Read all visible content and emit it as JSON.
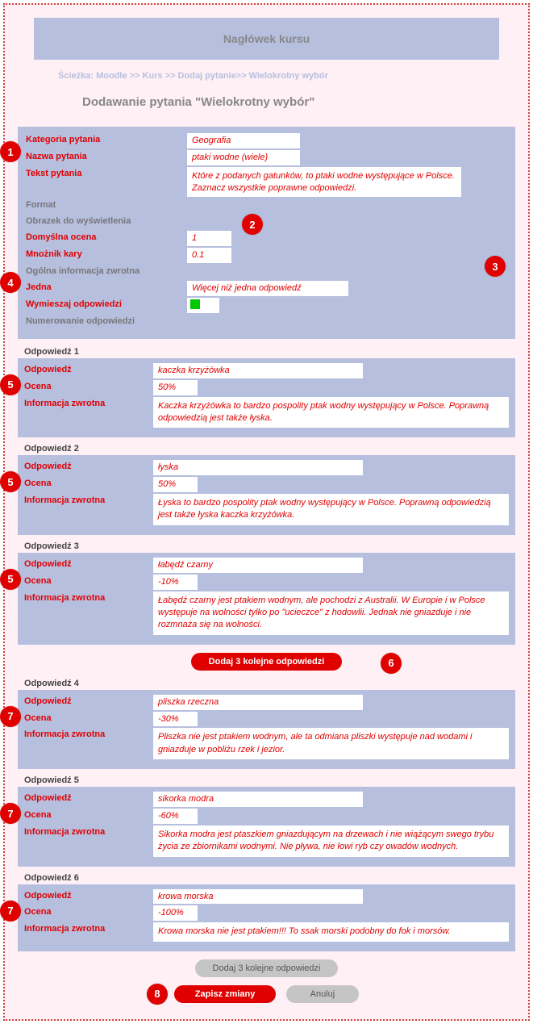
{
  "header": {
    "course_title": "Nagłówek kursu",
    "breadcrumb": "Ścieżka: Moodle >> Kurs >> Dodaj pytanie>> Wielokrotny wybór",
    "page_title": "Dodawanie pytania \"Wielokrotny wybór\""
  },
  "form": {
    "labels": {
      "category": "Kategoria pytania",
      "name": "Nazwa pytania",
      "text": "Tekst pytania",
      "format": "Format",
      "image": "Obrazek do wyświetlenia",
      "default_grade": "Domyślna ocena",
      "penalty": "Mnożnik kary",
      "general_fb": "Ogólna informacja zwrotna",
      "single": "Jedna",
      "shuffle": "Wymieszaj odpowiedzi",
      "numbering": "Numerowanie odpowiedzi"
    },
    "values": {
      "category": "Geografia",
      "name": "ptaki wodne (wiele)",
      "text": "Które z podanych gatunków, to ptaki wodne występujące w Polsce. Zaznacz wszystkie poprawne odpowiedzi.",
      "default_grade": "1",
      "penalty": "0.1",
      "single": "Więcej niż jedna odpowiedź"
    }
  },
  "ans_labels": {
    "answer": "Odpowiedź",
    "grade": "Ocena",
    "feedback": "Informacja zwrotna"
  },
  "answers": [
    {
      "title": "Odpowiedź 1",
      "answer": "kaczka krzyżówka",
      "grade": "50%",
      "feedback": "Kaczka krzyżówka to bardzo pospolity ptak wodny występujący w Polsce. Poprawną odpowiedzią jest także łyska."
    },
    {
      "title": "Odpowiedź 2",
      "answer": "łyska",
      "grade": "50%",
      "feedback": "Łyska to bardzo pospolity ptak wodny występujący w Polsce. Poprawną odpowiedzią jest także łyska kaczka krzyżówka."
    },
    {
      "title": "Odpowiedź 3",
      "answer": "łabędź czarny",
      "grade": "-10%",
      "feedback": "Łabędź czarny jest ptakiem wodnym, ale pochodzi z Australii. W Europie i w Polsce występuje na wolności tylko po \"ucieczce\" z hodowlii. Jednak nie gniazduje i nie rozmnaża się na wolności."
    },
    {
      "title": "Odpowiedź 4",
      "answer": "pliszka rzeczna",
      "grade": "-30%",
      "feedback": "Pliszka nie jest ptakiem wodnym, ale ta odmiana pliszki występuje nad wodami i gniazduje w pobliżu rzek i jezior."
    },
    {
      "title": "Odpowiedź 5",
      "answer": "sikorka modra",
      "grade": "-60%",
      "feedback": "Sikorka modra jest ptaszkiem gniazdującym na drzewach i nie wiążącym swego trybu życia ze zbiornikami wodnymi. Nie pływa, nie łowi ryb czy owadów wodnych."
    },
    {
      "title": "Odpowiedź 6",
      "answer": "krowa morska",
      "grade": "-100%",
      "feedback": "Krowa morska nie jest ptakiem!!! To ssak morski podobny do fok i morsów."
    }
  ],
  "buttons": {
    "add_more_red": "Dodaj 3 kolejne odpowiedzi",
    "add_more_grey": "Dodaj 3 kolejne odpowiedzi",
    "save": "Zapisz zmiany",
    "cancel": "Anuluj"
  },
  "callouts": {
    "c1": "1",
    "c2": "2",
    "c3": "3",
    "c4": "4",
    "c5": "5",
    "c6": "6",
    "c7": "7",
    "c8": "8"
  }
}
